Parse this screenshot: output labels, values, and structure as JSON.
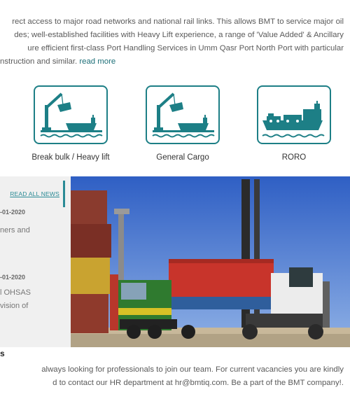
{
  "intro": {
    "line1": "rect access to major road networks and national rail links. This allows BMT to service major oil",
    "line2": "des; well-established facilities with Heavy Lift experience, a range of 'Value Added' & Ancillary",
    "line3": "ure efficient first-class Port Handling Services in Umm Qasr Port North Port with particular",
    "line4": "nstruction and similar.",
    "read_more": "read more"
  },
  "services": [
    {
      "label": "Break bulk / Heavy lift",
      "icon": "crane-ship-icon"
    },
    {
      "label": "General Cargo",
      "icon": "crane-ship-icon"
    },
    {
      "label": "RORO",
      "icon": "roro-ship-icon"
    }
  ],
  "news": {
    "read_all": "READ ALL NEWS",
    "items": [
      {
        "date": "-01-2020",
        "text1": "ners  and",
        "text2": ""
      },
      {
        "date": "-01-2020",
        "text1": "l  OHSAS",
        "text2": "vision of"
      }
    ]
  },
  "careers": {
    "title": "s",
    "line1": "always looking for professionals to join our team. For current vacancies you are kindly",
    "line2": "d to contact our HR department at hr@bmtiq.com. Be a part of the BMT company!."
  },
  "colors": {
    "accent": "#1d7f86",
    "link": "#1d6f78",
    "news_bg": "#f0f0f0"
  }
}
